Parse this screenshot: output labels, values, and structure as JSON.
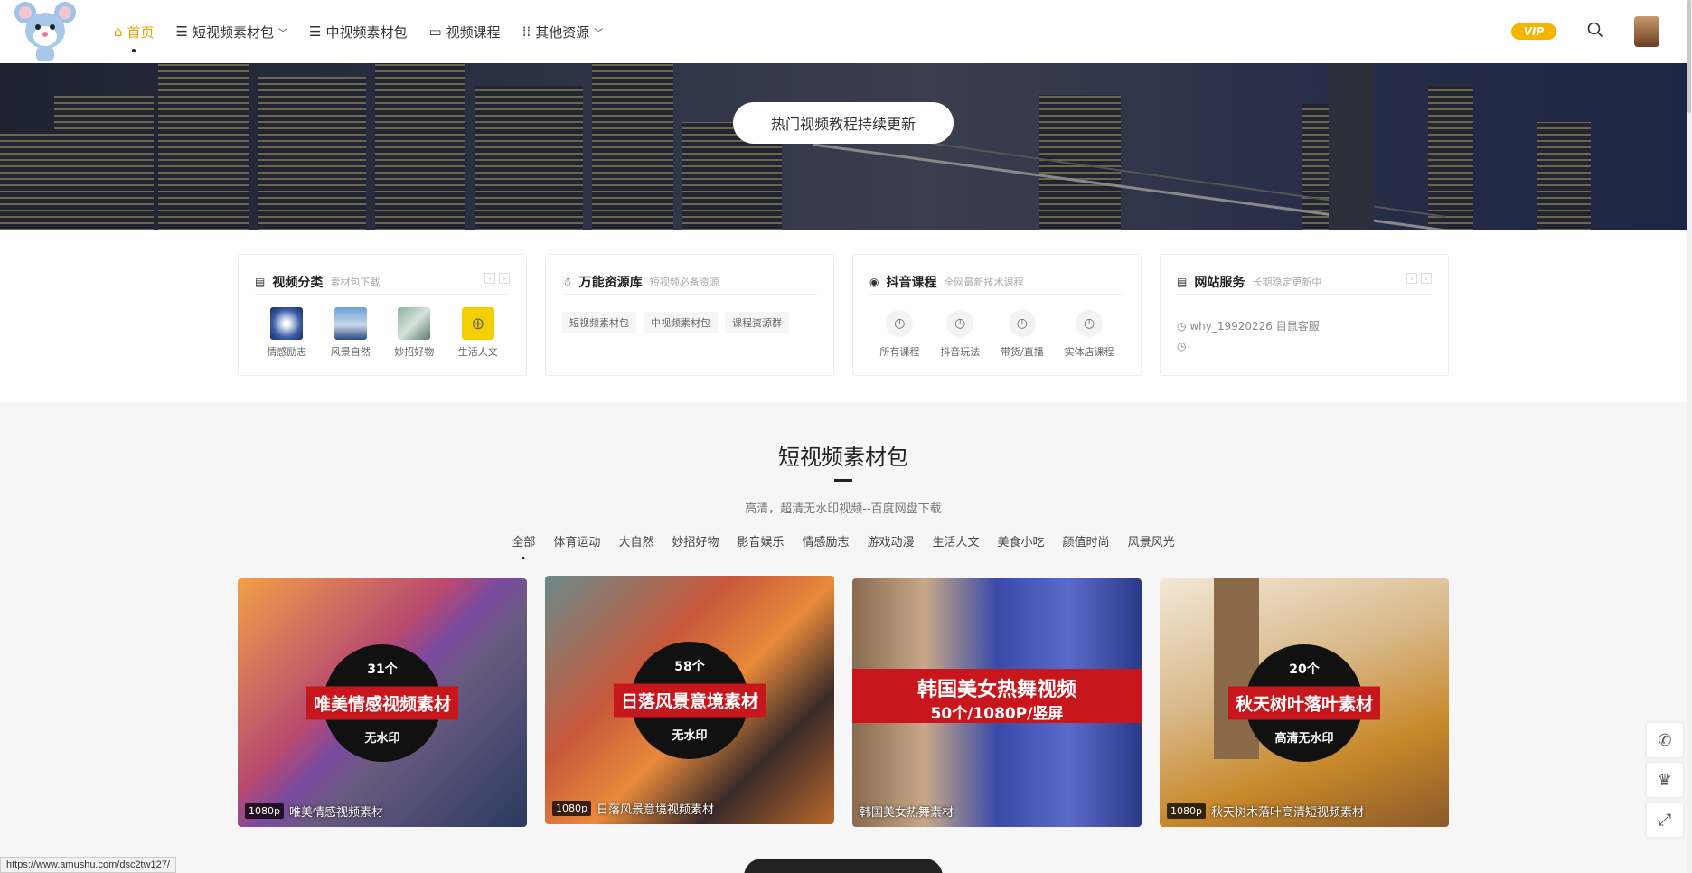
{
  "nav": {
    "items": [
      {
        "label": "首页",
        "icon": "home-icon",
        "active": true
      },
      {
        "label": "短视频素材包",
        "icon": "list-icon",
        "dropdown": true
      },
      {
        "label": "中视频素材包",
        "icon": "list-icon"
      },
      {
        "label": "视频课程",
        "icon": "video-window-icon"
      },
      {
        "label": "其他资源",
        "icon": "grid-icon",
        "dropdown": true
      }
    ],
    "vip_label": "VIP"
  },
  "banner": {
    "button_label": "热门视频教程持续更新"
  },
  "cards": [
    {
      "title": "视频分类",
      "sub": "素材包下载",
      "items": [
        "情感励志",
        "风景自然",
        "妙招好物",
        "生活人文"
      ]
    },
    {
      "title": "万能资源库",
      "sub": "短视频必备资源",
      "tags": [
        "短视频素材包",
        "中视频素材包",
        "课程资源群"
      ]
    },
    {
      "title": "抖音课程",
      "sub": "全网最新技术课程",
      "items": [
        "所有课程",
        "抖音玩法",
        "带货/直播",
        "实体店课程"
      ]
    },
    {
      "title": "网站服务",
      "sub": "长期稳定更新中",
      "lines": [
        "why_19920226 目鼠客服",
        ""
      ]
    }
  ],
  "section": {
    "title": "短视频素材包",
    "subtitle": "高清，超清无水印视频--百度网盘下载",
    "filters": [
      "全部",
      "体育运动",
      "大自然",
      "妙招好物",
      "影音娱乐",
      "情感励志",
      "游戏动漫",
      "生活人文",
      "美食小吃",
      "颜值时尚",
      "风景风光"
    ]
  },
  "thumbs": [
    {
      "count": "31个",
      "banner": "唯美情感视频素材",
      "bottom": "无水印",
      "res": "1080p",
      "caption": "唯美情感视频素材"
    },
    {
      "count": "58个",
      "banner": "日落风景意境素材",
      "bottom": "无水印",
      "res": "1080p",
      "caption": "日落风景意境视频素材"
    },
    {
      "count": "",
      "banner": "韩国美女热舞视频",
      "bottom": "50个/1080P/竖屏",
      "res": "",
      "caption": "韩国美女热舞素材"
    },
    {
      "count": "20个",
      "banner": "秋天树叶落叶素材",
      "bottom": "高清无水印",
      "res": "1080p",
      "caption": "秋天树木落叶高清短视频素材"
    }
  ],
  "status_url": "https://www.amushu.com/dsc2tw127/"
}
